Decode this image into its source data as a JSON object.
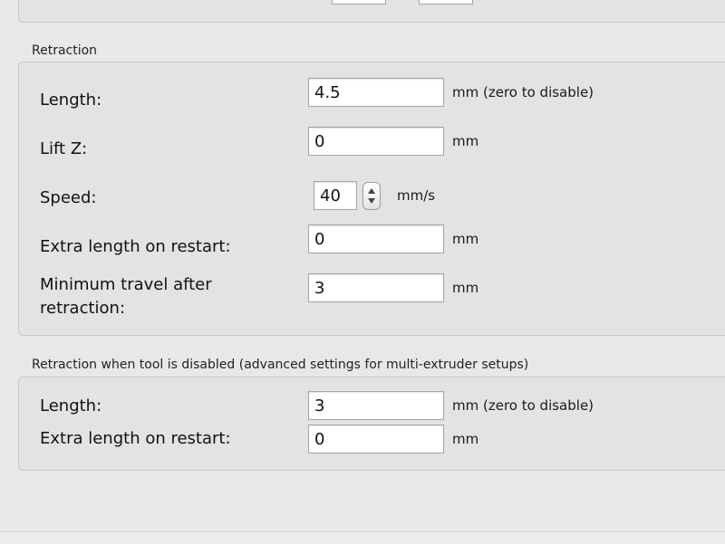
{
  "retraction": {
    "title": "Retraction",
    "length": {
      "label": "Length:",
      "value": "4.5",
      "unit": "mm (zero to disable)"
    },
    "lift_z": {
      "label": "Lift Z:",
      "value": "0",
      "unit": "mm"
    },
    "speed": {
      "label": "Speed:",
      "value": "40",
      "unit": "mm/s"
    },
    "extra_length": {
      "label": "Extra length on restart:",
      "value": "0",
      "unit": "mm"
    },
    "min_travel": {
      "label": "Minimum travel after retraction:",
      "value": "3",
      "unit": "mm"
    }
  },
  "tool_disabled": {
    "title": "Retraction when tool is disabled (advanced settings for multi-extruder setups)",
    "length": {
      "label": "Length:",
      "value": "3",
      "unit": "mm (zero to disable)"
    },
    "extra_length": {
      "label": "Extra length on restart:",
      "value": "0",
      "unit": "mm"
    }
  }
}
